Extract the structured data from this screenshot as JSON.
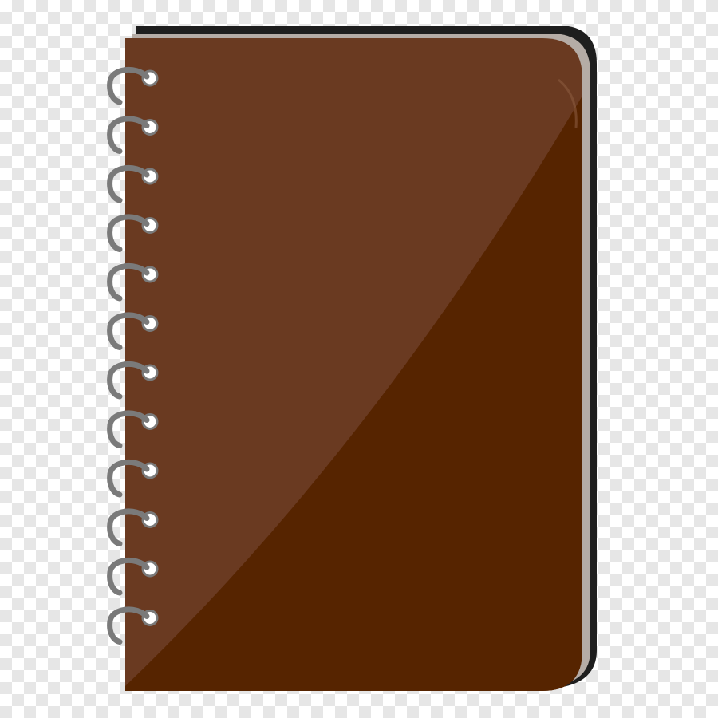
{
  "notebook": {
    "cover_color": "#6a3a21",
    "cover_shade_color": "#562400",
    "back_color": "#1e1e1e",
    "page_edge_color": "#b5aca6",
    "spiral_color": "#7a7a7a",
    "hole_color": "#ffffff",
    "spiral_ring_count": 12,
    "background": "transparent-checkerboard"
  }
}
